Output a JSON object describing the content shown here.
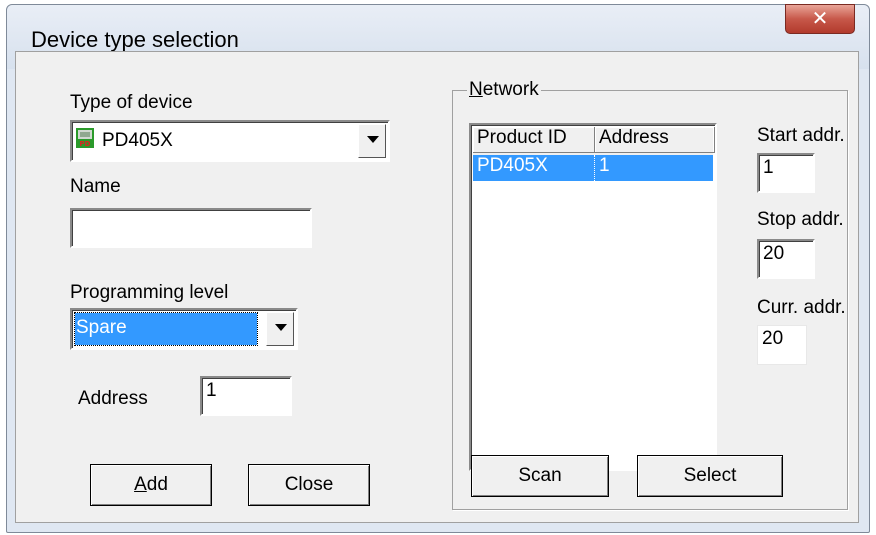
{
  "window": {
    "title": "Device type selection",
    "close_glyph": "✕"
  },
  "device_type": {
    "label": "Type of device",
    "selected": "PD405X",
    "icon": "pd-device-icon"
  },
  "name_field": {
    "label": "Name",
    "value": ""
  },
  "programming_level": {
    "label": "Programming level",
    "selected": "Spare"
  },
  "address_field": {
    "label": "Address",
    "value": "1"
  },
  "buttons": {
    "add": "Add",
    "add_mnemonic": "A",
    "add_rest": "dd",
    "close": "Close",
    "scan": "Scan",
    "select": "Select"
  },
  "network": {
    "group_label": "Network",
    "group_mnemonic": "N",
    "group_rest": "etwork",
    "columns": [
      "Product ID",
      "Address"
    ],
    "rows": [
      {
        "product_id": "PD405X",
        "address": "1"
      }
    ],
    "start_addr": {
      "label": "Start addr.",
      "value": "1"
    },
    "stop_addr": {
      "label": "Stop addr.",
      "value": "20"
    },
    "curr_addr": {
      "label": "Curr. addr.",
      "value": "20"
    }
  },
  "colors": {
    "selection": "#3399ff",
    "title_close": "#c7584a"
  }
}
